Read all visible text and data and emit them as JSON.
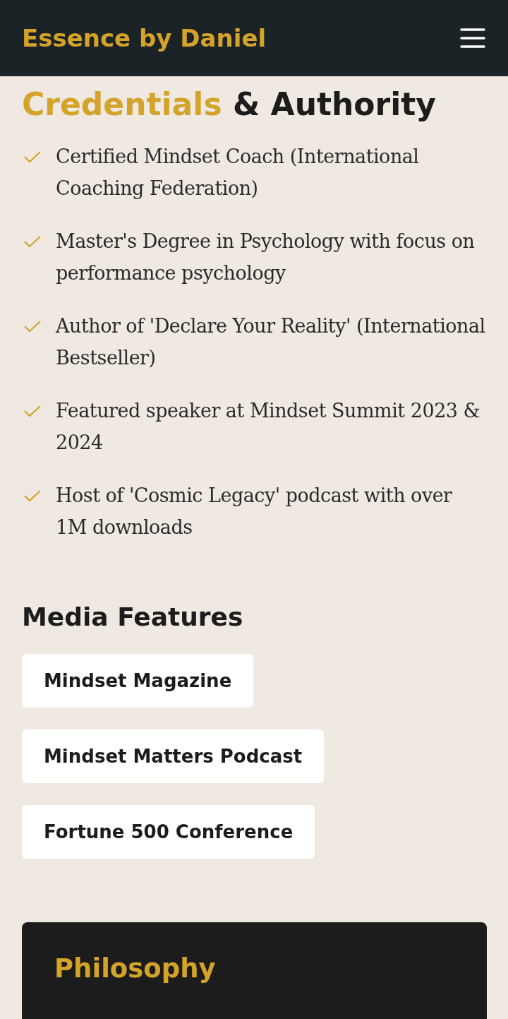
{
  "header": {
    "title": "Essence by Daniel"
  },
  "credentials": {
    "title_highlight": "Credentials",
    "title_rest": "& Authority",
    "items": [
      "Certified Mindset Coach (International Coaching Federation)",
      "Master's Degree in Psychology with focus on performance psychology",
      "Author of 'Declare Your Reality' (International Bestseller)",
      "Featured speaker at Mindset Summit 2023 & 2024",
      "Host of 'Cosmic Legacy' podcast with over 1M downloads"
    ]
  },
  "media": {
    "title": "Media Features",
    "items": [
      "Mindset Magazine",
      "Mindset Matters Podcast",
      "Fortune 500 Conference"
    ]
  },
  "philosophy": {
    "title": "Philosophy"
  }
}
